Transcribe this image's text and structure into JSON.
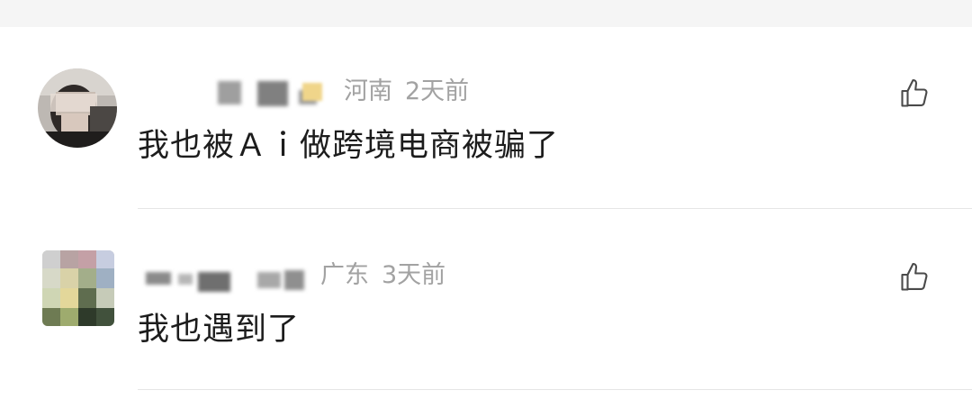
{
  "comments": [
    {
      "region": "河南",
      "time": "2天前",
      "text": "我也被Ａｉ做跨境电商被骗了",
      "avatar_icon": "blurred-user-avatar",
      "like_icon": "thumbs-up-outline-icon"
    },
    {
      "region": "广东",
      "time": "3天前",
      "text": "我也遇到了",
      "avatar_icon": "blurred-user-avatar",
      "like_icon": "thumbs-up-outline-icon"
    }
  ],
  "colors": {
    "background": "#ffffff",
    "top_strip": "#f5f5f5",
    "meta_text": "#a2a2a2",
    "comment_text": "#1c1c1c",
    "divider": "#e6e6e6"
  }
}
